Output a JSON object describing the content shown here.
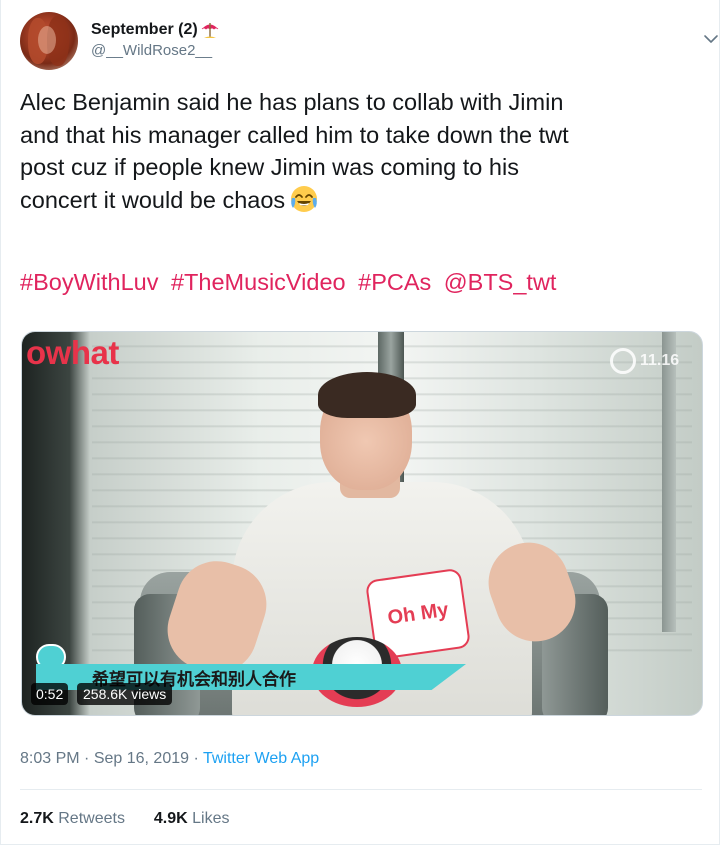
{
  "user": {
    "display_name": "September (2)",
    "handle": "@__WildRose2__",
    "name_emoji": "umbrella-on-ground-icon"
  },
  "tweet": {
    "lines": [
      "Alec Benjamin said he has plans to collab with Jimin",
      "and that his manager called him to take down the twt",
      "post cuz if people knew Jimin was coming to his",
      "concert it would be chaos"
    ],
    "trailing_emoji": "face-with-tears-of-joy-icon",
    "hashtags": [
      "#BoyWithLuv",
      "#TheMusicVideo",
      "#PCAs",
      "@BTS_twt"
    ]
  },
  "media": {
    "watermark_logo": "owhat",
    "watermark_right": "11.16",
    "sticker_text": "Oh My",
    "subtitle": "希望可以有机会和别人合作",
    "duration": "0:52",
    "views": "258.6K views"
  },
  "meta": {
    "time": "8:03 PM",
    "separator": "·",
    "date": "Sep 16, 2019",
    "source": "Twitter Web App"
  },
  "stats": {
    "retweets_count": "2.7K",
    "retweets_label": "Retweets",
    "likes_count": "4.9K",
    "likes_label": "Likes"
  },
  "colors": {
    "hashtag": "#e0245e",
    "link": "#1da1f2",
    "secondary_text": "#657786",
    "primary_text": "#14171a"
  }
}
